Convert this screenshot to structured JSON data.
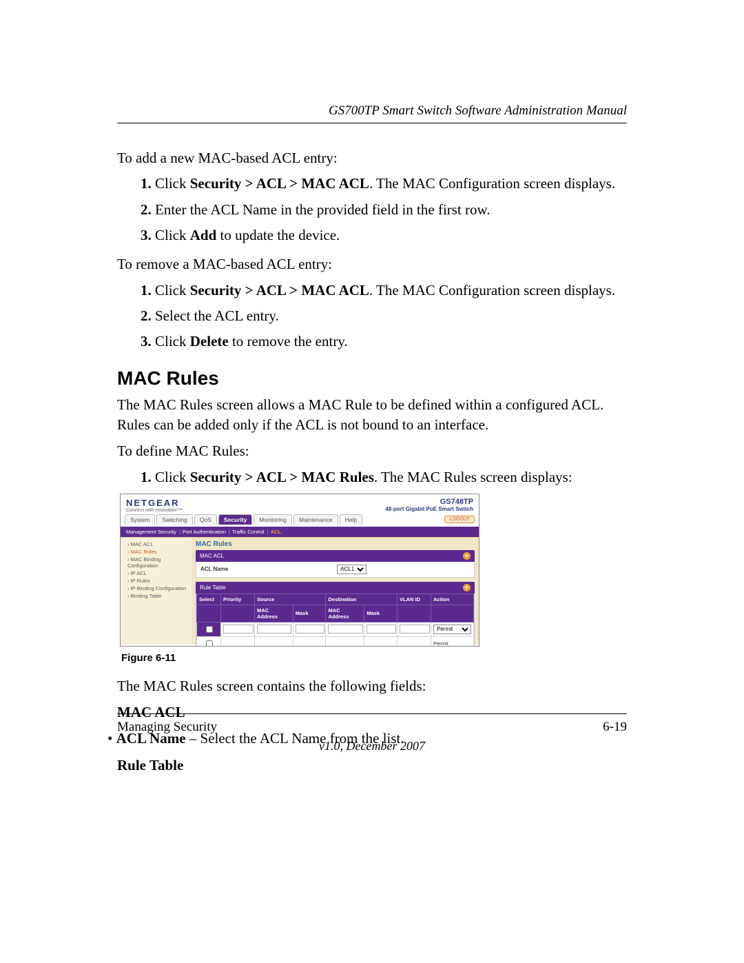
{
  "header": "GS700TP Smart Switch Software Administration Manual",
  "intro_add": "To add a new MAC-based ACL entry:",
  "add_steps": [
    {
      "pre": "Click ",
      "b": "Security > ACL > MAC ACL",
      "post": ". The MAC Configuration screen displays."
    },
    {
      "pre": "Enter the ACL Name in the provided field in the first row.",
      "b": "",
      "post": ""
    },
    {
      "pre": "Click ",
      "b": "Add",
      "post": " to update the device."
    }
  ],
  "intro_remove": "To remove a MAC-based ACL entry:",
  "remove_steps": [
    {
      "pre": "Click ",
      "b": "Security > ACL > MAC ACL",
      "post": ". The MAC Configuration screen displays."
    },
    {
      "pre": "Select the ACL entry.",
      "b": "",
      "post": ""
    },
    {
      "pre": "Click ",
      "b": "Delete",
      "post": " to remove the entry."
    }
  ],
  "section_heading": "MAC Rules",
  "section_para": "The MAC Rules screen allows a MAC Rule to be defined within a configured ACL. Rules can be added only if the ACL is not bound to an interface.",
  "define_intro": "To define MAC Rules:",
  "define_step": {
    "pre": "Click ",
    "b": "Security > ACL > MAC Rules",
    "post": ". The MAC Rules screen displays:"
  },
  "figure_caption": "Figure 6-11",
  "after_fig": "The MAC Rules screen contains the following fields:",
  "subhead1": "MAC ACL",
  "bullet1": {
    "b": "ACL Name",
    "post": " – Select the ACL Name from the list."
  },
  "subhead2": "Rule Table",
  "footer": {
    "left": "Managing Security",
    "right": "6-19",
    "ver": "v1.0, December 2007"
  },
  "shot": {
    "brand": "NETGEAR",
    "tagline": "Connect with Innovation™",
    "model_num": "GS748TP",
    "model_desc": "48-port Gigabit PoE Smart Switch",
    "tabs": [
      "System",
      "Switching",
      "QoS",
      "Security",
      "Monitoring",
      "Maintenance",
      "Help"
    ],
    "tab_selected": "Security",
    "logout": "LOGOUT",
    "subtabs": [
      "Management Security",
      "Port Authentication",
      "Traffic Control",
      "ACL"
    ],
    "subtab_hl": "ACL",
    "side": [
      "› MAC ACL",
      "› MAC Rules",
      "› MAC Binding Configuration",
      "› IP ACL",
      "› IP Rules",
      "› IP Binding Configuration",
      "› Binding Table"
    ],
    "side_selected": 1,
    "content_title": "MAC Rules",
    "panel1": "MAC ACL",
    "acl_label": "ACL Name",
    "acl_value": "ACL1",
    "panel2": "Rule Table",
    "cols": [
      "Select",
      "Priority",
      "Source MAC Address",
      "Mask",
      "Destination MAC Address",
      "Mask",
      "VLAN ID",
      "Action"
    ],
    "action_sel": "Permit",
    "action_ro": "Permit"
  }
}
